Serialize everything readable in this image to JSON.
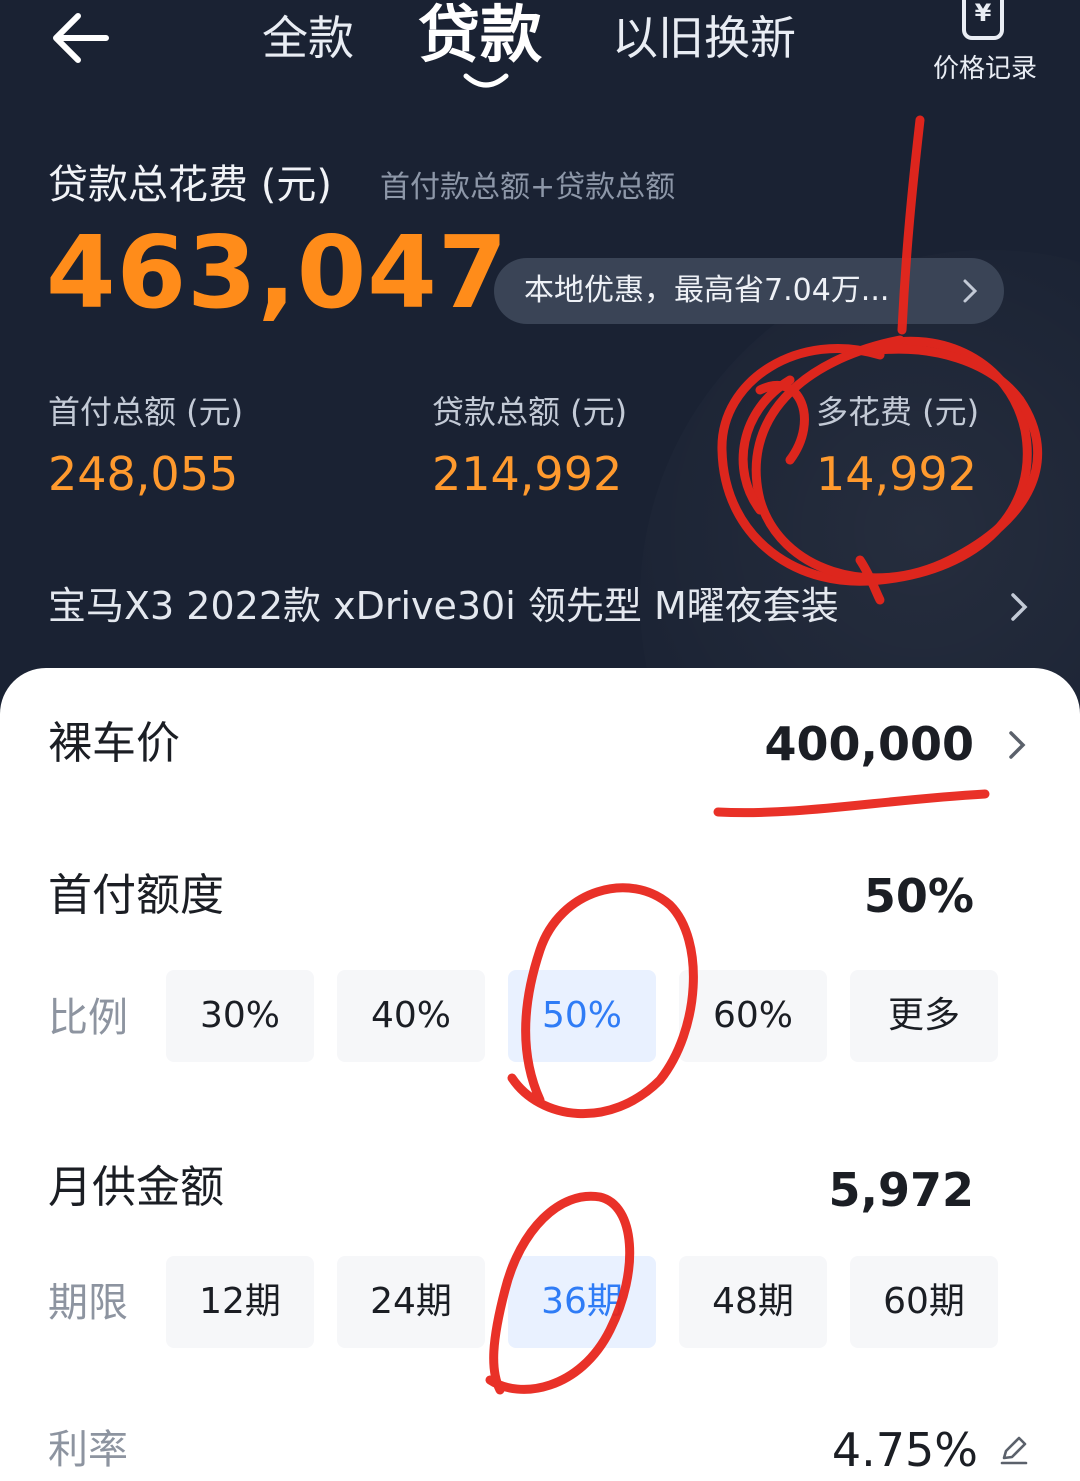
{
  "nav": {
    "tabs": [
      {
        "label": "全款"
      },
      {
        "label": "贷款"
      },
      {
        "label": "以旧换新"
      }
    ],
    "price_record": {
      "icon_text": "¥",
      "label": "价格记录"
    }
  },
  "summary": {
    "total_label": "贷款总花费 (元)",
    "total_sub": "首付款总额+贷款总额",
    "total_value": "463,047",
    "promo": "本地优惠，最高省7.04万...",
    "stats": [
      {
        "label": "首付总额 (元)",
        "value": "248,055"
      },
      {
        "label": "贷款总额 (元)",
        "value": "214,992"
      },
      {
        "label": "多花费 (元)",
        "value": "14,992"
      }
    ],
    "car_name": "宝马X3 2022款 xDrive30i 领先型 M曜夜套装"
  },
  "form": {
    "price": {
      "label": "裸车价",
      "value": "400,000"
    },
    "down_payment": {
      "label": "首付额度",
      "value": "50%",
      "option_label": "比例",
      "options": [
        "30%",
        "40%",
        "50%",
        "60%",
        "更多"
      ],
      "selected_index": 2
    },
    "monthly": {
      "label": "月供金额",
      "value": "5,972",
      "option_label": "期限",
      "options": [
        "12期",
        "24期",
        "36期",
        "48期",
        "60期"
      ],
      "selected_index": 2
    },
    "rate": {
      "label": "利率",
      "value": "4.75%"
    }
  },
  "colors": {
    "header_bg": "#1a2233",
    "accent_orange": "#ff8c1a",
    "selected_blue": "#2f7cf6",
    "annotation_red": "#e8261c"
  }
}
